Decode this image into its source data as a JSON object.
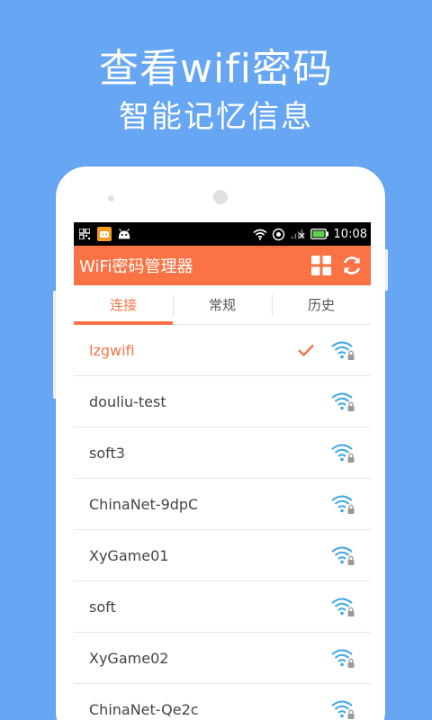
{
  "promo": {
    "headline": "查看wifi密码",
    "subline": "智能记忆信息"
  },
  "statusbar": {
    "time": "10:08",
    "left_icons": [
      "qr-grid-icon",
      "game-app-icon",
      "android-icon"
    ],
    "right_icons": [
      "wifi-signal-icon",
      "sync-icon",
      "cell-signal-icon",
      "battery-icon"
    ]
  },
  "appbar": {
    "title": "WiFi密码管理器",
    "actions": [
      "grid-icon",
      "refresh-icon"
    ]
  },
  "tabs": [
    {
      "label": "连接",
      "active": true
    },
    {
      "label": "常规",
      "active": false
    },
    {
      "label": "历史",
      "active": false
    }
  ],
  "networks": [
    {
      "ssid": "lzgwifi",
      "connected": true
    },
    {
      "ssid": "douliu-test",
      "connected": false
    },
    {
      "ssid": "soft3",
      "connected": false
    },
    {
      "ssid": "ChinaNet-9dpC",
      "connected": false
    },
    {
      "ssid": "XyGame01",
      "connected": false
    },
    {
      "ssid": "soft",
      "connected": false
    },
    {
      "ssid": "XyGame02",
      "connected": false
    },
    {
      "ssid": "ChinaNet-Qe2c",
      "connected": false
    }
  ],
  "colors": {
    "background": "#67a6f2",
    "accent": "#fb7345",
    "wifi_icon": "#3ea6e6"
  }
}
